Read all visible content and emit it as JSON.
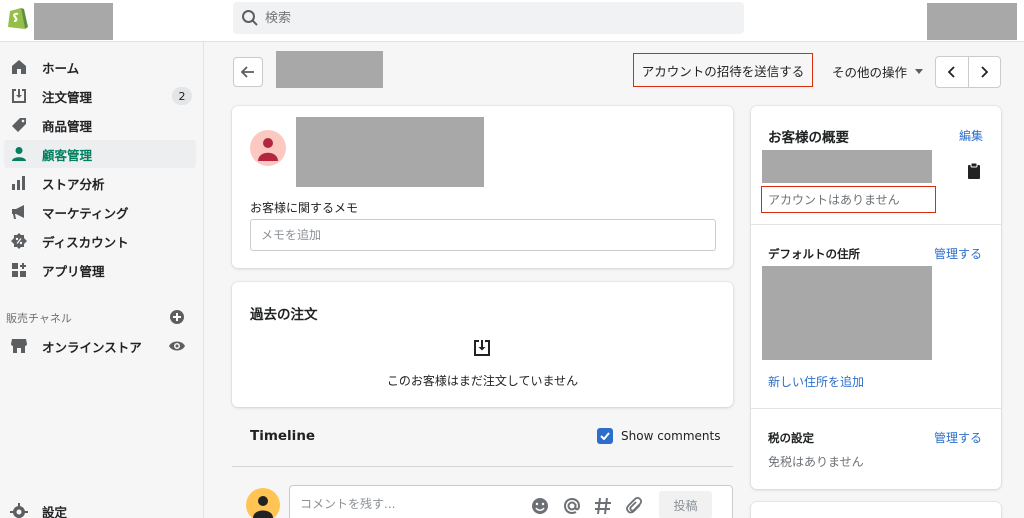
{
  "search": {
    "placeholder": "検索"
  },
  "sidebar": {
    "items": [
      {
        "label": "ホーム",
        "icon": "home-icon"
      },
      {
        "label": "注文管理",
        "icon": "orders-icon",
        "badge": "2"
      },
      {
        "label": "商品管理",
        "icon": "tag-icon"
      },
      {
        "label": "顧客管理",
        "icon": "person-icon",
        "active": true
      },
      {
        "label": "ストア分析",
        "icon": "analytics-icon"
      },
      {
        "label": "マーケティング",
        "icon": "megaphone-icon"
      },
      {
        "label": "ディスカウント",
        "icon": "discount-icon"
      },
      {
        "label": "アプリ管理",
        "icon": "apps-icon"
      }
    ],
    "sales_channel_label": "販売チャネル",
    "online_store_label": "オンラインストア",
    "settings_label": "設定"
  },
  "header": {
    "invite_label": "アカウントの招待を送信する",
    "more_actions_label": "その他の操作"
  },
  "customer_card": {
    "memo_label": "お客様に関するメモ",
    "memo_placeholder": "メモを追加"
  },
  "orders_card": {
    "title": "過去の注文",
    "empty_text": "このお客様はまだ注文していません"
  },
  "timeline": {
    "title": "Timeline",
    "show_comments_label": "Show comments",
    "show_comments_checked": true,
    "comment_placeholder": "コメントを残す...",
    "post_label": "投稿"
  },
  "overview": {
    "title": "お客様の概要",
    "edit_label": "編集",
    "no_account_text": "アカウントはありません",
    "default_address_title": "デフォルトの住所",
    "manage_label": "管理する",
    "add_address_label": "新しい住所を追加",
    "tax_title": "税の設定",
    "tax_manage_label": "管理する",
    "tax_status": "免税はありません"
  },
  "colors": {
    "accent_green": "#008060",
    "link_blue": "#2c6ecb",
    "highlight_red": "#d82c0d"
  }
}
